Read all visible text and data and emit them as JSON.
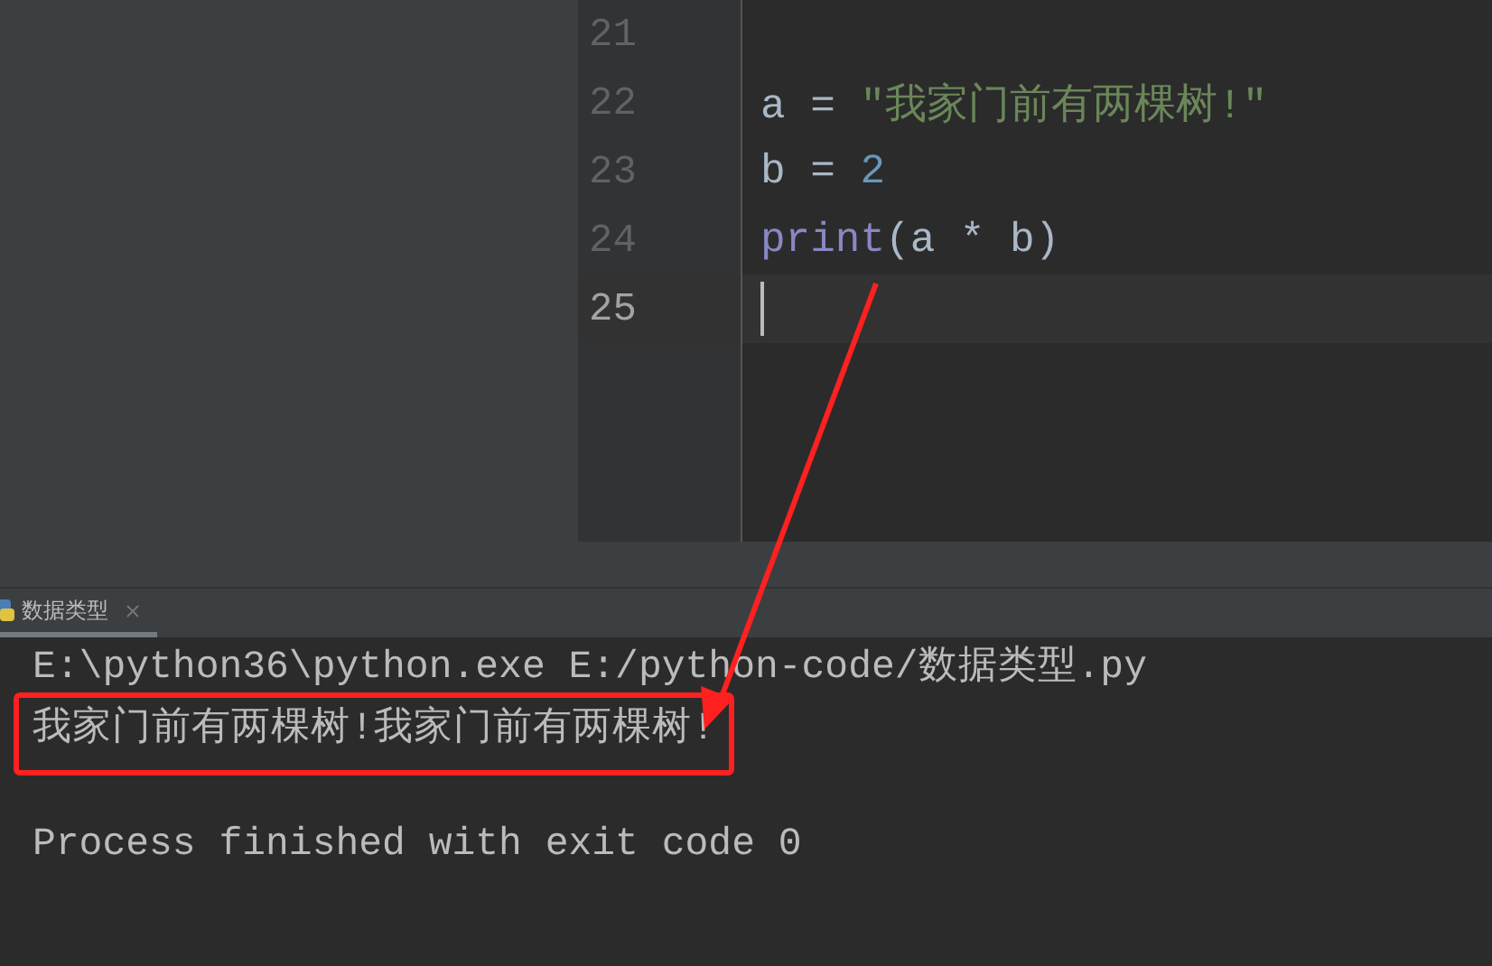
{
  "editor": {
    "lines": [
      {
        "number": "21",
        "current": false
      },
      {
        "number": "22",
        "current": false,
        "tokens": [
          {
            "text": "a = ",
            "kind": "plain"
          },
          {
            "text": "\"我家门前有两棵树!\"",
            "kind": "string"
          }
        ]
      },
      {
        "number": "23",
        "current": false,
        "tokens": [
          {
            "text": "b = ",
            "kind": "plain"
          },
          {
            "text": "2",
            "kind": "number"
          }
        ]
      },
      {
        "number": "24",
        "current": false,
        "tokens": [
          {
            "text": "print",
            "kind": "builtin"
          },
          {
            "text": "(a * b)",
            "kind": "plain"
          }
        ]
      },
      {
        "number": "25",
        "current": true
      }
    ]
  },
  "console": {
    "tab": {
      "label": "数据类型",
      "selected": true
    },
    "lines": [
      {
        "text": "E:\\python36\\python.exe E:/python-code/数据类型.py",
        "kind": "command",
        "highlighted": false
      },
      {
        "text": "我家门前有两棵树!我家门前有两棵树!",
        "kind": "output",
        "highlighted": true
      },
      {
        "text": "Process finished with exit code 0",
        "kind": "info",
        "highlighted": false
      }
    ]
  }
}
